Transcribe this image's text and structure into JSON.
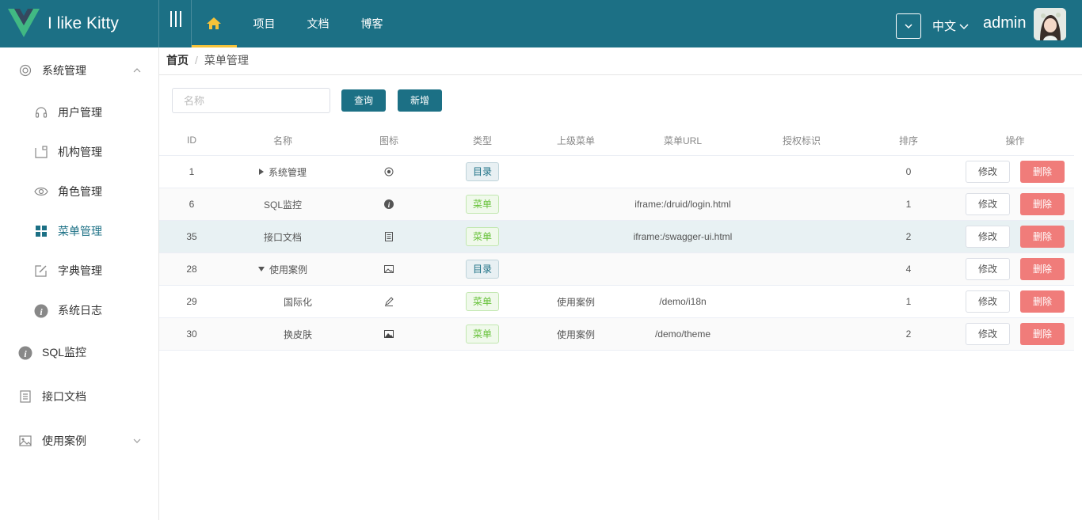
{
  "header": {
    "app_title": "I like Kitty",
    "nav": [
      {
        "label": "项目"
      },
      {
        "label": "文档"
      },
      {
        "label": "博客"
      }
    ],
    "language": "中文",
    "username": "admin",
    "icons": {
      "logo": "vue-logo",
      "menu_toggle": "collapse-icon",
      "home": "home-icon",
      "dropdown": "chevron-down-icon"
    }
  },
  "sidebar": {
    "items": [
      {
        "label": "系统管理",
        "icon": "gear-icon",
        "expanded": true
      },
      {
        "label": "用户管理",
        "icon": "headset-icon"
      },
      {
        "label": "机构管理",
        "icon": "organization-icon"
      },
      {
        "label": "角色管理",
        "icon": "eye-icon"
      },
      {
        "label": "菜单管理",
        "icon": "grid-icon",
        "active": true
      },
      {
        "label": "字典管理",
        "icon": "edit-icon"
      },
      {
        "label": "系统日志",
        "icon": "info-icon"
      },
      {
        "label": "SQL监控",
        "icon": "info-icon"
      },
      {
        "label": "接口文档",
        "icon": "document-icon"
      },
      {
        "label": "使用案例",
        "icon": "picture-icon",
        "expanded": false
      }
    ]
  },
  "breadcrumb": {
    "home": "首页",
    "separator": "/",
    "current": "菜单管理"
  },
  "toolbar": {
    "search_placeholder": "名称",
    "search_value": "",
    "query_label": "查询",
    "add_label": "新增"
  },
  "table": {
    "headers": [
      "ID",
      "名称",
      "图标",
      "类型",
      "上级菜单",
      "菜单URL",
      "授权标识",
      "排序",
      "操作"
    ],
    "edit_label": "修改",
    "delete_label": "删除",
    "rows": [
      {
        "id": "1",
        "name": "系统管理",
        "tree": "collapsed",
        "icon": "gear-icon",
        "type": "目录",
        "parent": "",
        "url": "",
        "perms": "",
        "order": "0"
      },
      {
        "id": "6",
        "name": "SQL监控",
        "tree": "",
        "icon": "info-icon",
        "type": "菜单",
        "parent": "",
        "url": "iframe:/druid/login.html",
        "perms": "",
        "order": "1"
      },
      {
        "id": "35",
        "name": "接口文档",
        "tree": "",
        "icon": "document-icon",
        "type": "菜单",
        "parent": "",
        "url": "iframe:/swagger-ui.html",
        "perms": "",
        "order": "2"
      },
      {
        "id": "28",
        "name": "使用案例",
        "tree": "expanded",
        "icon": "picture-outline-icon",
        "type": "目录",
        "parent": "",
        "url": "",
        "perms": "",
        "order": "4"
      },
      {
        "id": "29",
        "name": "国际化",
        "tree": "child",
        "icon": "edit-outline-icon",
        "type": "菜单",
        "parent": "使用案例",
        "url": "/demo/i18n",
        "perms": "",
        "order": "1"
      },
      {
        "id": "30",
        "name": "换皮肤",
        "tree": "child",
        "icon": "picture-icon",
        "type": "菜单",
        "parent": "使用案例",
        "url": "/demo/theme",
        "perms": "",
        "order": "2"
      }
    ]
  },
  "colors": {
    "primary": "#1c7085",
    "accent": "#f5c33a",
    "danger": "#f07c7a",
    "success": "#67c23a"
  }
}
